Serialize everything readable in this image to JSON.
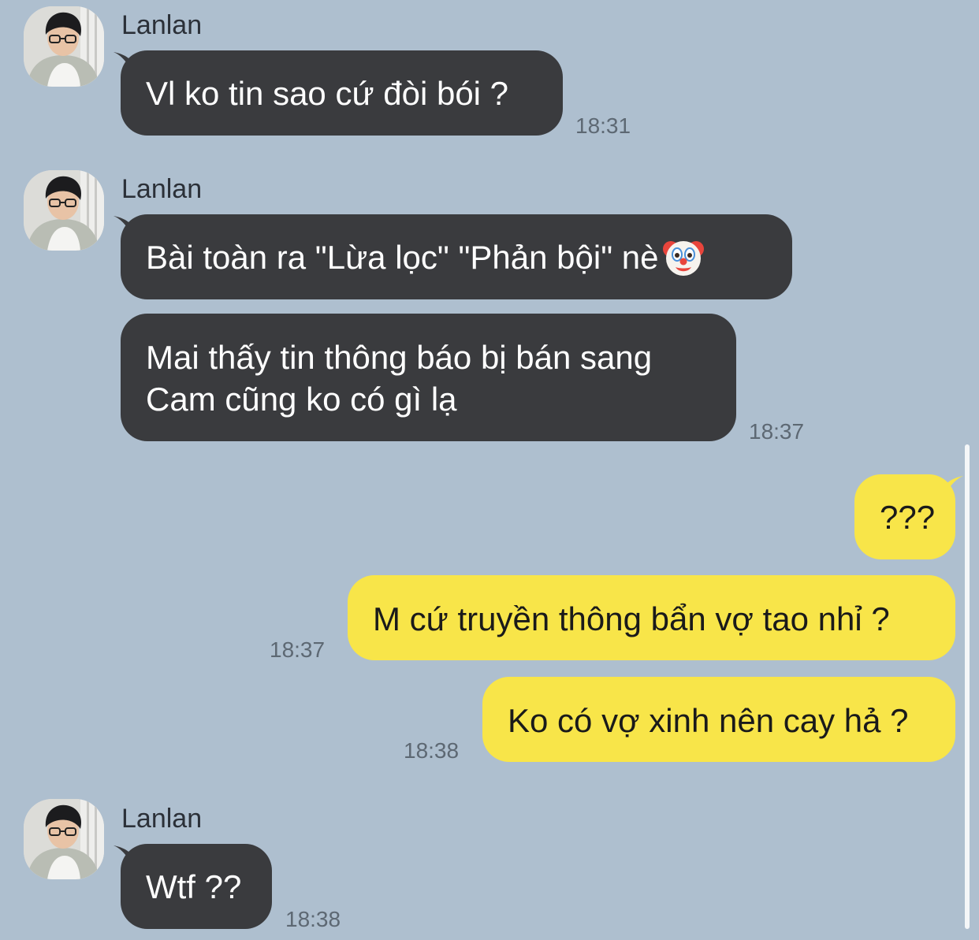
{
  "contact": {
    "name": "Lanlan"
  },
  "colors": {
    "background": "#aebfcf",
    "incoming_bubble": "#3a3b3e",
    "outgoing_bubble": "#f8e549"
  },
  "messages": [
    {
      "direction": "incoming",
      "sender": "Lanlan",
      "text": "Vl ko tin sao cứ đòi bói ?",
      "time": "18:31"
    },
    {
      "direction": "incoming",
      "sender": "Lanlan",
      "text": "Bài toàn ra \"Lừa lọc\" \"Phản bội\" nè",
      "emoji": "clown-face-emoji"
    },
    {
      "direction": "incoming",
      "line1": "Mai thấy tin thông báo bị bán sang",
      "line2": "Cam cũng ko có gì lạ",
      "time": "18:37"
    },
    {
      "direction": "outgoing",
      "text": "???"
    },
    {
      "direction": "outgoing",
      "text": "M cứ truyền thông bẩn vợ tao nhỉ ?",
      "time": "18:37"
    },
    {
      "direction": "outgoing",
      "text": "Ko có vợ xinh nên cay hả ?",
      "time": "18:38"
    },
    {
      "direction": "incoming",
      "sender": "Lanlan",
      "text": "Wtf ??",
      "time": "18:38"
    }
  ]
}
